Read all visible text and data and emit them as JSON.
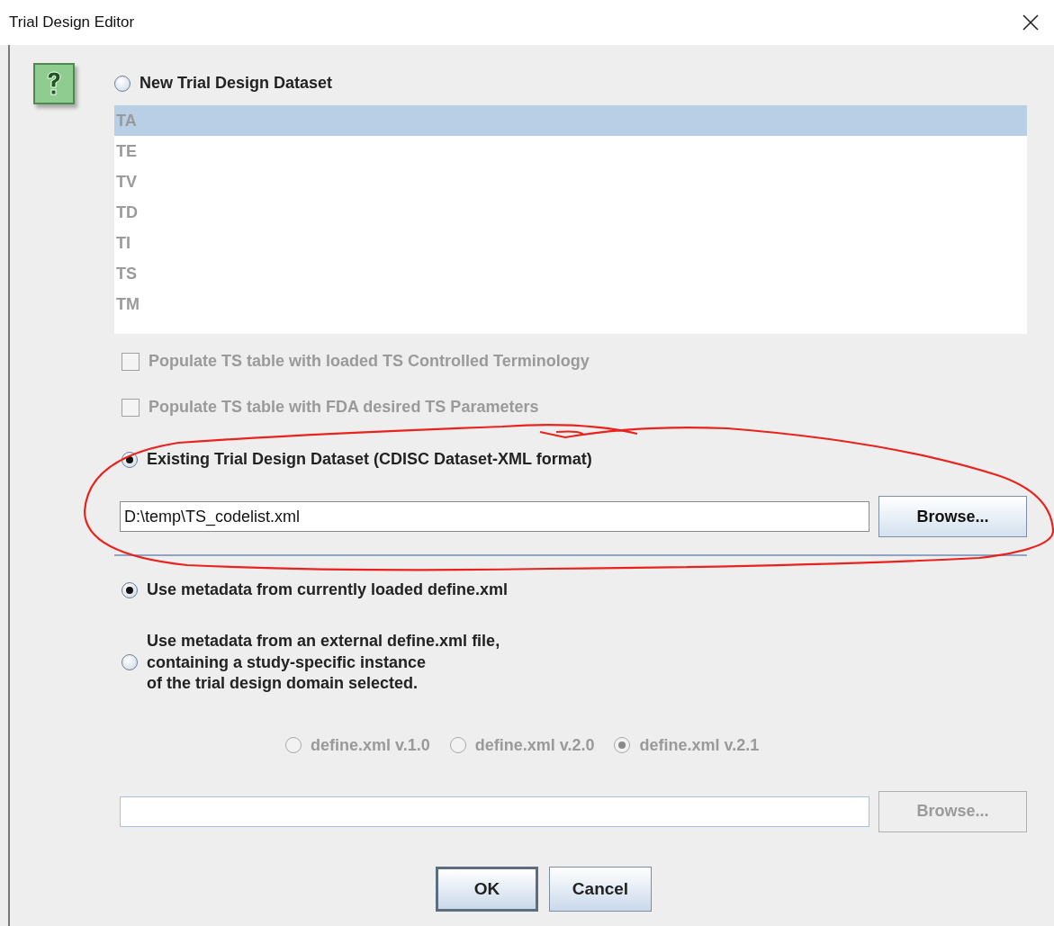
{
  "window": {
    "title": "Trial Design Editor"
  },
  "new_dataset": {
    "label": "New Trial Design Dataset",
    "selected": false
  },
  "domain_list": {
    "disabled": true,
    "items": [
      {
        "label": "TA",
        "selected": true
      },
      {
        "label": "TE",
        "selected": false
      },
      {
        "label": "TV",
        "selected": false
      },
      {
        "label": "TD",
        "selected": false
      },
      {
        "label": "TI",
        "selected": false
      },
      {
        "label": "TS",
        "selected": false
      },
      {
        "label": "TM",
        "selected": false
      }
    ]
  },
  "options": [
    {
      "label": "Populate TS table with loaded TS Controlled Terminology",
      "checked": false,
      "disabled": true
    },
    {
      "label": "Populate TS table with FDA desired TS Parameters",
      "checked": false,
      "disabled": true
    }
  ],
  "existing_dataset": {
    "label": "Existing Trial Design Dataset (CDISC Dataset-XML format)",
    "selected": true,
    "path": "D:\\temp\\TS_codelist.xml",
    "browse_button": {
      "label": "Browse...",
      "disabled": false
    }
  },
  "metadata_sources": [
    {
      "label": "Use metadata from currently loaded define.xml",
      "selected": true
    },
    {
      "label": "Use metadata from an external define.xml file,\ncontaining a study-specific instance\nof the trial design domain selected.",
      "selected": false
    }
  ],
  "define_versions": {
    "disabled": true,
    "options": [
      {
        "label": "define.xml v.1.0",
        "selected": false
      },
      {
        "label": "define.xml v.2.0",
        "selected": false
      },
      {
        "label": "define.xml v.2.1",
        "selected": true
      }
    ]
  },
  "define_file": {
    "browse_button": {
      "label": "Browse...",
      "disabled": true
    }
  },
  "buttons": [
    {
      "label": "OK",
      "default": true
    },
    {
      "label": "Cancel",
      "default": false
    }
  ]
}
